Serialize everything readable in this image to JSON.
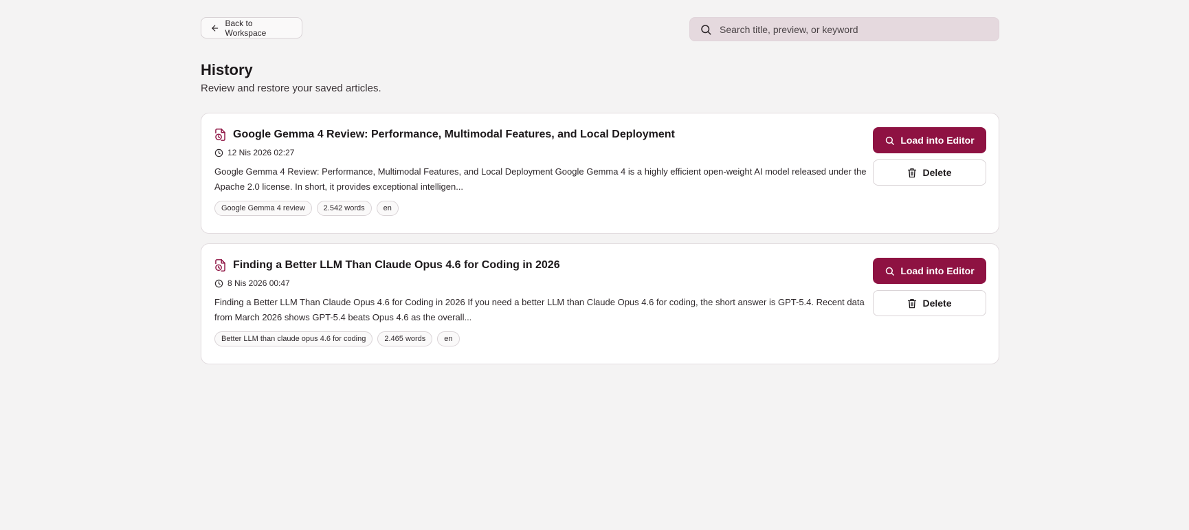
{
  "header": {
    "back_label": "Back to Workspace",
    "back_icon": "arrow-left-icon",
    "search_placeholder": "Search title, preview, or keyword",
    "search_value": "",
    "search_icon": "search-icon"
  },
  "page": {
    "title": "History",
    "subtitle": "Review and restore your saved articles."
  },
  "articles": [
    {
      "title": "Google Gemma 4 Review: Performance, Multimodal Features, and Local Deployment",
      "date": "12 Nis 2026 02:27",
      "preview": "Google Gemma 4 Review: Performance, Multimodal Features, and Local Deployment Google Gemma 4 is a highly efficient open-weight AI model released under the Apache 2.0 license. In short, it provides exceptional intelligen...",
      "tags": [
        "Google Gemma 4 review",
        "2.542 words",
        "en"
      ]
    },
    {
      "title": "Finding a Better LLM Than Claude Opus 4.6 for Coding in 2026",
      "date": "8 Nis 2026 00:47",
      "preview": "Finding a Better LLM Than Claude Opus 4.6 for Coding in 2026 If you need a better LLM than Claude Opus 4.6 for coding, the short answer is GPT-5.4. Recent data from March 2026 shows GPT-5.4 beats Opus 4.6 as the overall...",
      "tags": [
        "Better LLM than claude opus 4.6 for coding",
        "2.465 words",
        "en"
      ]
    }
  ],
  "actions": {
    "load_label": "Load into Editor",
    "delete_label": "Delete"
  },
  "colors": {
    "accent": "#8e1242",
    "background": "#f4f3f3",
    "search_bg": "#e5d9de"
  }
}
